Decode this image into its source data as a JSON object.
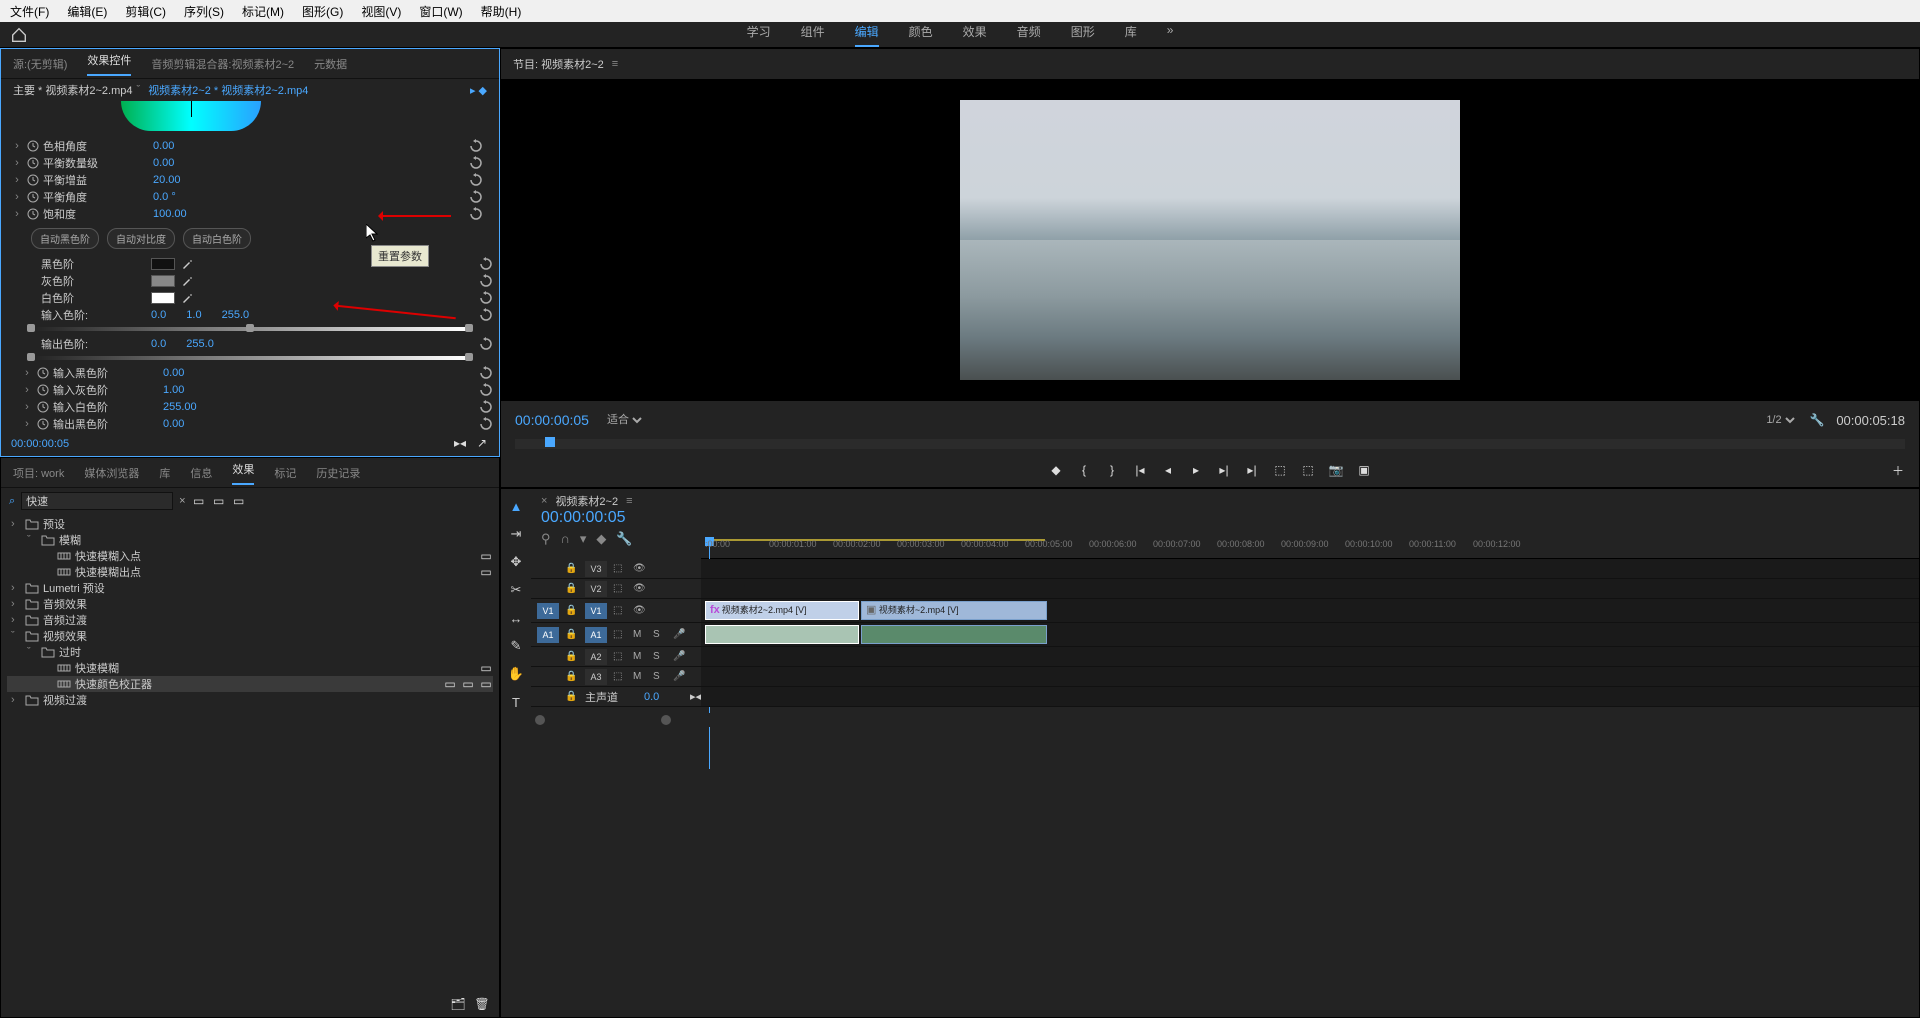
{
  "menu": [
    "文件(F)",
    "编辑(E)",
    "剪辑(C)",
    "序列(S)",
    "标记(M)",
    "图形(G)",
    "视图(V)",
    "窗口(W)",
    "帮助(H)"
  ],
  "workspaces": {
    "items": [
      "学习",
      "组件",
      "编辑",
      "颜色",
      "效果",
      "音频",
      "图形",
      "库"
    ],
    "active": "编辑",
    "overflow": "»"
  },
  "source_panel": {
    "tabs": [
      "源:(无剪辑)",
      "效果控件",
      "音频剪辑混合器:视频素材2~2",
      "元数据"
    ],
    "active_tab": "效果控件",
    "breadcrumb_main": "主要 * 视频素材2~2.mp4",
    "breadcrumb_seq": "视频素材2~2 * 视频素材2~2.mp4",
    "params": [
      {
        "label": "色相角度",
        "value": "0.00"
      },
      {
        "label": "平衡数量级",
        "value": "0.00"
      },
      {
        "label": "平衡增益",
        "value": "20.00"
      },
      {
        "label": "平衡角度",
        "value": "0.0 °"
      },
      {
        "label": "饱和度",
        "value": "100.00"
      }
    ],
    "auto_buttons": [
      "自动黑色阶",
      "自动对比度",
      "自动白色阶"
    ],
    "levels": [
      {
        "label": "黑色阶",
        "swatch": "#111"
      },
      {
        "label": "灰色阶",
        "swatch": "#888"
      },
      {
        "label": "白色阶",
        "swatch": "#fff"
      }
    ],
    "input_levels": {
      "label": "输入色阶:",
      "low": "0.0",
      "mid": "1.0",
      "high": "255.0"
    },
    "output_levels": {
      "label": "输出色阶:",
      "low": "0.0",
      "high": "255.0"
    },
    "channel_params": [
      {
        "label": "输入黑色阶",
        "value": "0.00"
      },
      {
        "label": "输入灰色阶",
        "value": "1.00"
      },
      {
        "label": "输入白色阶",
        "value": "255.00"
      },
      {
        "label": "输出黑色阶",
        "value": "0.00"
      }
    ],
    "timecode": "00:00:00:05",
    "tooltip": "重置参数"
  },
  "project_panel": {
    "tabs": [
      "项目: work",
      "媒体浏览器",
      "库",
      "信息",
      "效果",
      "标记",
      "历史记录"
    ],
    "active_tab": "效果",
    "search_value": "快速",
    "tree": [
      {
        "caret": "›",
        "icon": "folder",
        "label": "预设",
        "indent": 0
      },
      {
        "caret": "ˇ",
        "icon": "folder",
        "label": "模糊",
        "indent": 1
      },
      {
        "caret": "",
        "icon": "strip",
        "label": "快速模糊入点",
        "indent": 2,
        "badge": true
      },
      {
        "caret": "",
        "icon": "strip",
        "label": "快速模糊出点",
        "indent": 2,
        "badge": true
      },
      {
        "caret": "›",
        "icon": "folder",
        "label": "Lumetri 预设",
        "indent": 0
      },
      {
        "caret": "›",
        "icon": "folder",
        "label": "音频效果",
        "indent": 0
      },
      {
        "caret": "›",
        "icon": "folder",
        "label": "音频过渡",
        "indent": 0
      },
      {
        "caret": "ˇ",
        "icon": "folder",
        "label": "视频效果",
        "indent": 0
      },
      {
        "caret": "ˇ",
        "icon": "folder",
        "label": "过时",
        "indent": 1
      },
      {
        "caret": "",
        "icon": "strip",
        "label": "快速模糊",
        "indent": 2,
        "badge": true
      },
      {
        "caret": "",
        "icon": "strip",
        "label": "快速颜色校正器",
        "indent": 2,
        "selected": true,
        "badge": true,
        "badge2": true
      },
      {
        "caret": "›",
        "icon": "folder",
        "label": "视频过渡",
        "indent": 0
      }
    ]
  },
  "program_panel": {
    "title": "节目: 视频素材2~2",
    "timecode": "00:00:00:05",
    "fit": "适合",
    "resolution": "1/2",
    "duration": "00:00:05:18"
  },
  "timeline_panel": {
    "tabs": [
      "视频素材2~2"
    ],
    "timecode": "00:00:00:05",
    "ruler_labels": [
      ":00:00",
      "00:00:01:00",
      "00:00:02:00",
      "00:00:03:00",
      "00:00:04:00",
      "00:00:05:00",
      "00:00:06:00",
      "00:00:07:00",
      "00:00:08:00",
      "00:00:09:00",
      "00:00:10:00",
      "00:00:11:00",
      "00:00:12:00"
    ],
    "tracks": {
      "v3": {
        "label": "V3"
      },
      "v2": {
        "label": "V2"
      },
      "v1": {
        "label": "V1",
        "src_on": true,
        "tgt_on": true
      },
      "a1": {
        "label": "A1",
        "src_on": true,
        "tgt_on": true,
        "m": "M",
        "s": "S"
      },
      "a2": {
        "label": "A2",
        "m": "M",
        "s": "S"
      },
      "a3": {
        "label": "A3",
        "m": "M",
        "s": "S"
      },
      "master": {
        "label": "主声道",
        "value": "0.0"
      }
    },
    "clips": {
      "v1a": {
        "name": "视频素材2~2.mp4 [V]",
        "fx": "fx"
      },
      "v1b": {
        "name": "视频素材~2.mp4 [V]"
      }
    }
  },
  "chart_data": null
}
